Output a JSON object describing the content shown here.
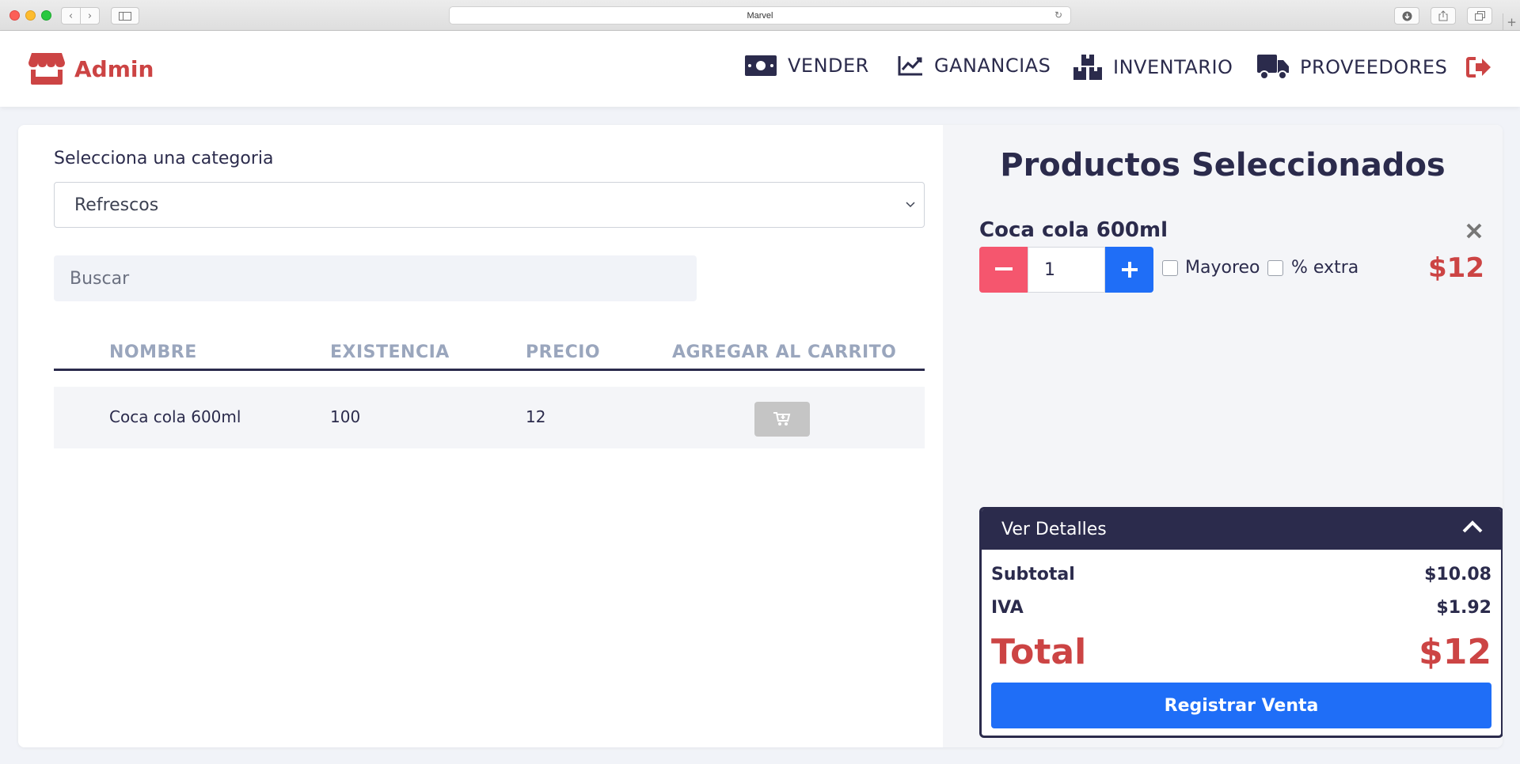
{
  "browser": {
    "url_title": "Marvel"
  },
  "brand": {
    "name": "Admin",
    "color": "#cc4444"
  },
  "nav": {
    "items": [
      {
        "label": "VENDER",
        "icon": "money-bill-icon"
      },
      {
        "label": "GANANCIAS",
        "icon": "chart-line-icon"
      },
      {
        "label": "INVENTARIO",
        "icon": "boxes-icon"
      },
      {
        "label": "PROVEEDORES",
        "icon": "truck-icon"
      }
    ],
    "logout_icon": "sign-out-icon"
  },
  "catalog": {
    "category_label": "Selecciona una categoria",
    "category_selected": "Refrescos",
    "search_placeholder": "Buscar",
    "table": {
      "headers": [
        "NOMBRE",
        "EXISTENCIA",
        "PRECIO",
        "AGREGAR AL CARRITO"
      ],
      "rows": [
        {
          "nombre": "Coca cola 600ml",
          "existencia": "100",
          "precio": "12"
        }
      ]
    }
  },
  "cart": {
    "title": "Productos Seleccionados",
    "items": [
      {
        "name": "Coca cola 600ml",
        "quantity": "1",
        "mayoreo_label": "Mayoreo",
        "extra_label": "% extra",
        "price": "$12"
      }
    ],
    "details": {
      "title": "Ver Detalles",
      "subtotal_label": "Subtotal",
      "subtotal_value": "$10.08",
      "iva_label": "IVA",
      "iva_value": "$1.92",
      "total_label": "Total",
      "total_value": "$12",
      "register_label": "Registrar Venta"
    }
  },
  "colors": {
    "primary_dark": "#2b2b4c",
    "accent_red": "#cc4444",
    "button_blue": "#1f6ef7",
    "minus_pink": "#f5566e"
  }
}
